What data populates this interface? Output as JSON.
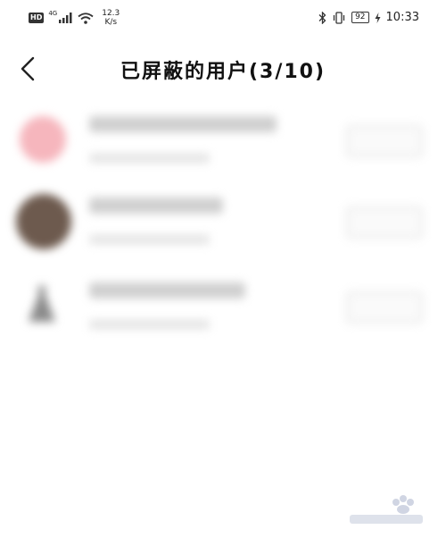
{
  "status_bar": {
    "hd": "HD",
    "network": "4G",
    "speed_value": "12.3",
    "speed_unit": "K/s",
    "battery": "92",
    "time": "10:33"
  },
  "header": {
    "title": "已屏蔽的用户(3/10)"
  },
  "users": [
    {
      "name": "",
      "subtitle": "",
      "action": ""
    },
    {
      "name": "",
      "subtitle": "",
      "action": ""
    },
    {
      "name": "",
      "subtitle": "",
      "action": ""
    }
  ]
}
